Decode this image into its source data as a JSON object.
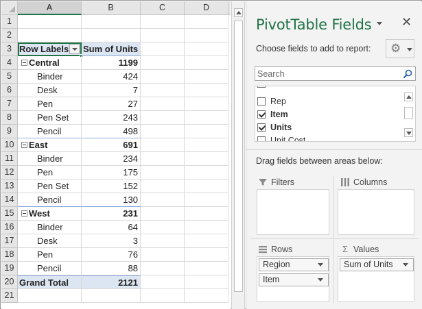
{
  "sheet": {
    "columns": [
      "A",
      "B",
      "C",
      "D"
    ],
    "active_column": "A",
    "rows": [
      {
        "num": "1",
        "a": "",
        "b": ""
      },
      {
        "num": "2",
        "a": "",
        "b": ""
      },
      {
        "num": "3",
        "a": "Row Labels",
        "b": "Sum of Units"
      },
      {
        "num": "4",
        "a": "Central",
        "b": "1199"
      },
      {
        "num": "5",
        "a": "Binder",
        "b": "424"
      },
      {
        "num": "6",
        "a": "Desk",
        "b": "7"
      },
      {
        "num": "7",
        "a": "Pen",
        "b": "27"
      },
      {
        "num": "8",
        "a": "Pen Set",
        "b": "243"
      },
      {
        "num": "9",
        "a": "Pencil",
        "b": "498"
      },
      {
        "num": "10",
        "a": "East",
        "b": "691"
      },
      {
        "num": "11",
        "a": "Binder",
        "b": "234"
      },
      {
        "num": "12",
        "a": "Pen",
        "b": "175"
      },
      {
        "num": "13",
        "a": "Pen Set",
        "b": "152"
      },
      {
        "num": "14",
        "a": "Pencil",
        "b": "130"
      },
      {
        "num": "15",
        "a": "West",
        "b": "231"
      },
      {
        "num": "16",
        "a": "Binder",
        "b": "64"
      },
      {
        "num": "17",
        "a": "Desk",
        "b": "3"
      },
      {
        "num": "18",
        "a": "Pen",
        "b": "76"
      },
      {
        "num": "19",
        "a": "Pencil",
        "b": "88"
      },
      {
        "num": "20",
        "a": "Grand Total",
        "b": "2121"
      },
      {
        "num": "21",
        "a": "",
        "b": ""
      }
    ]
  },
  "pane": {
    "title": "PivotTable Fields",
    "choose_label": "Choose fields to add to report:",
    "search_placeholder": "Search",
    "fields": [
      {
        "label": "Rep",
        "checked": false
      },
      {
        "label": "Item",
        "checked": true
      },
      {
        "label": "Units",
        "checked": true
      },
      {
        "label": "Unit Cost",
        "checked": false
      }
    ],
    "drag_label": "Drag fields between areas below:",
    "areas": {
      "filters": {
        "label": "Filters",
        "items": []
      },
      "columns": {
        "label": "Columns",
        "items": []
      },
      "rows": {
        "label": "Rows",
        "items": [
          "Region",
          "Item"
        ]
      },
      "values": {
        "label": "Values",
        "items": [
          "Sum of Units"
        ]
      }
    }
  },
  "colors": {
    "accent_green": "#217346",
    "pivot_header_fill": "#dce6f2",
    "pane_background": "#f3f3f3"
  }
}
